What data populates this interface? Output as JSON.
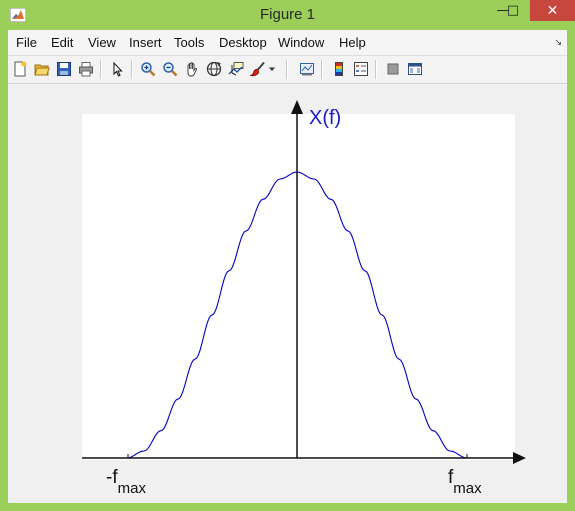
{
  "window": {
    "title": "Figure 1",
    "minimize_glyph": "—",
    "maximize_glyph": "□",
    "close_glyph": "✕"
  },
  "menu": {
    "items": [
      {
        "label": "File"
      },
      {
        "label": "Edit"
      },
      {
        "label": "View"
      },
      {
        "label": "Insert"
      },
      {
        "label": "Tools"
      },
      {
        "label": "Desktop"
      },
      {
        "label": "Window"
      },
      {
        "label": "Help"
      }
    ],
    "overflow_glyph": "↘"
  },
  "toolbar": {
    "buttons": [
      {
        "icon": "new-figure-icon"
      },
      {
        "icon": "open-file-icon"
      },
      {
        "icon": "save-icon"
      },
      {
        "icon": "print-icon"
      },
      {
        "icon": "select-arrow-icon"
      },
      {
        "icon": "zoom-in-icon"
      },
      {
        "icon": "zoom-out-icon"
      },
      {
        "icon": "pan-hand-icon"
      },
      {
        "icon": "rotate-3d-icon"
      },
      {
        "icon": "data-cursor-icon"
      },
      {
        "icon": "brush-icon"
      },
      {
        "icon": "link-plot-icon"
      },
      {
        "icon": "colorbar-icon"
      },
      {
        "icon": "legend-icon"
      },
      {
        "icon": "hide-plot-tools-icon"
      },
      {
        "icon": "show-plot-tools-icon"
      }
    ]
  },
  "colors": {
    "curve": "#0000c8",
    "ylabel": "#1a1acc",
    "axes": "#111111"
  },
  "chart_data": {
    "type": "line",
    "title": "",
    "ylabel": "X(f)",
    "xlabel": "",
    "tick_labels": {
      "left": {
        "base": "-f",
        "sub": "max"
      },
      "right": {
        "base": "f",
        "sub": "max"
      }
    },
    "xlim": [
      -1.25,
      1.25
    ],
    "ylim": [
      0,
      1.2
    ],
    "grid": false,
    "series": [
      {
        "x": [
          -1.0,
          -0.9,
          -0.8,
          -0.7,
          -0.6,
          -0.5,
          -0.4,
          -0.3,
          -0.2,
          -0.1,
          0.0,
          0.1,
          0.2,
          0.3,
          0.4,
          0.5,
          0.6,
          0.7,
          0.8,
          0.9,
          1.0
        ],
        "values": [
          0.0,
          0.0245,
          0.0955,
          0.2061,
          0.3455,
          0.5,
          0.6545,
          0.7939,
          0.9045,
          0.9755,
          1.0,
          0.9755,
          0.9045,
          0.7939,
          0.6545,
          0.5,
          0.3455,
          0.2061,
          0.0955,
          0.0245,
          0.0
        ]
      }
    ]
  }
}
